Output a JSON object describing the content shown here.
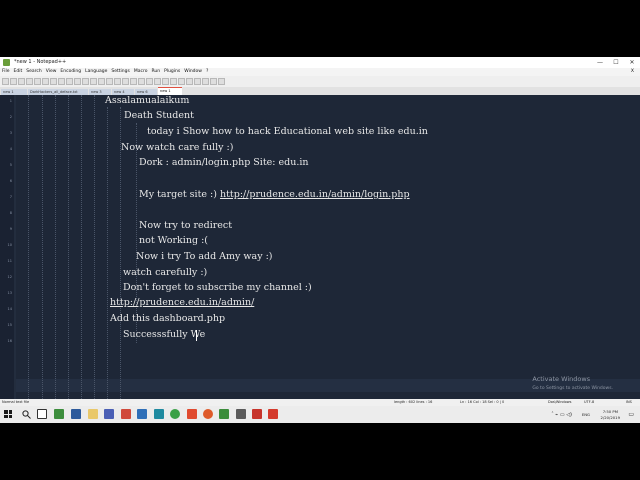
{
  "window": {
    "title": "*new 1 - Notepad++",
    "min": "—",
    "max": "☐",
    "close": "✕"
  },
  "menu": [
    "File",
    "Edit",
    "Search",
    "View",
    "Encoding",
    "Language",
    "Settings",
    "Macro",
    "Run",
    "Plugins",
    "Window",
    "?"
  ],
  "menu_close": "X",
  "tabs": [
    {
      "label": "new 1",
      "active": false
    },
    {
      "label": "DarkHackers_all_deface.txt",
      "active": false
    },
    {
      "label": "new 3",
      "active": false
    },
    {
      "label": "new 4",
      "active": false
    },
    {
      "label": "new 6",
      "active": false
    },
    {
      "label": "new 1",
      "active": true
    }
  ],
  "editor": {
    "line_numbers": [
      "1",
      "2",
      "3",
      "4",
      "5",
      "6",
      "7",
      "8",
      "9",
      "10",
      "11",
      "12",
      "13",
      "14",
      "15",
      "16"
    ],
    "lines": [
      "Assalamualaikum",
      "Death Student",
      "today i Show how to hack Educational web site like edu.in",
      "Now watch care fully :)",
      "Dork : admin/login.php Site: edu.in",
      "",
      "My target site :) ",
      "",
      "Now try to redirect",
      "not Working      :(",
      "Now i try To add Amy way :)",
      "watch carefully :)",
      "Don't forget to subscribe my channel :)",
      "",
      "Add this dashboard.php",
      "Successsfully We"
    ],
    "link_line7": "http://prudence.edu.in/admin/login.php",
    "link_line14": "http://prudence.edu.in/admin/"
  },
  "watermark": {
    "title": "Activate Windows",
    "subtitle": "Go to Settings to activate Windows."
  },
  "status": {
    "file_type": "Normal text file",
    "length": "length : 602    lines : 16",
    "position": "Ln : 16    Col : 18    Sel : 0 | 0",
    "eol": "Dos\\Windows",
    "encoding": "UTF-8",
    "mode": "INS"
  },
  "tray": {
    "lang": "ENG",
    "time": "7:50 PM",
    "date": "2/20/2019"
  },
  "colors": {
    "editor_bg": "#1e2737",
    "text": "#e8e8e8"
  }
}
